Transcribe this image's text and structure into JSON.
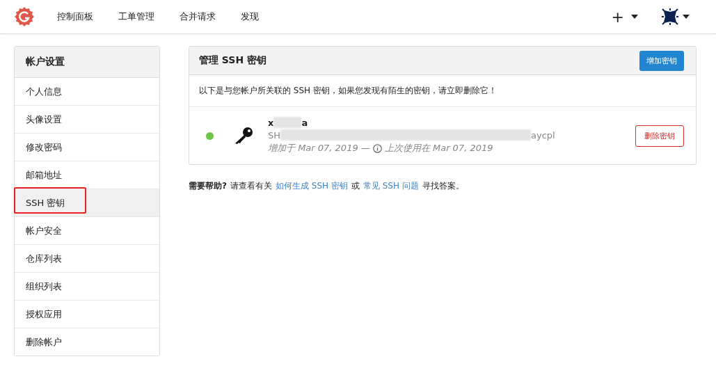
{
  "nav": {
    "items": [
      "控制面板",
      "工单管理",
      "合并请求",
      "发现"
    ],
    "create": "+"
  },
  "sidebar": {
    "title": "帐户设置",
    "items": [
      {
        "label": "个人信息",
        "selected": false,
        "highlighted": false
      },
      {
        "label": "头像设置",
        "selected": false,
        "highlighted": false
      },
      {
        "label": "修改密码",
        "selected": false,
        "highlighted": false
      },
      {
        "label": "邮箱地址",
        "selected": false,
        "highlighted": false
      },
      {
        "label": "SSH 密钥",
        "selected": true,
        "highlighted": true
      },
      {
        "label": "帐户安全",
        "selected": false,
        "highlighted": false
      },
      {
        "label": "仓库列表",
        "selected": false,
        "highlighted": false
      },
      {
        "label": "组织列表",
        "selected": false,
        "highlighted": false
      },
      {
        "label": "授权应用",
        "selected": false,
        "highlighted": false
      },
      {
        "label": "删除帐户",
        "selected": false,
        "highlighted": false
      }
    ]
  },
  "panel": {
    "title": "管理 SSH 密钥",
    "add_button": "增加密钥",
    "description": "以下是与您帐户所关联的 SSH 密钥，如果您发现有陌生的密钥，请立即删除它！",
    "keys": [
      {
        "name_start": "x",
        "name_end": "a",
        "fingerprint_start": "SH",
        "fingerprint_end": "aycpl",
        "added": "增加于 Mar 07, 2019 —",
        "last_used": "上次使用在 Mar 07, 2019",
        "active": true,
        "delete_button": "删除密钥"
      }
    ]
  },
  "help": {
    "label": "需要帮助?",
    "text_1": "请查看有关",
    "link_1": "如何生成 SSH 密钥",
    "text_2": "或",
    "link_2": "常见 SSH 问题",
    "text_3": "寻找答案。"
  }
}
